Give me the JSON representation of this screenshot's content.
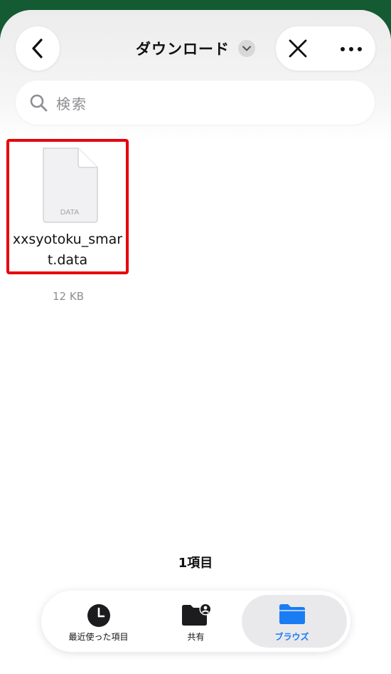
{
  "header": {
    "title": "ダウンロード",
    "back_icon": "chevron-left-icon",
    "title_menu_icon": "chevron-down-icon",
    "close_icon": "close-icon",
    "more_icon": "more-icon"
  },
  "search": {
    "placeholder": "検索",
    "icon": "search-icon"
  },
  "files": [
    {
      "name": "xxsyotoku_smart.data",
      "type_label": "DATA",
      "size": "12 KB",
      "selected": true
    }
  ],
  "item_count": "1項目",
  "tabs": [
    {
      "label": "最近使った項目",
      "icon": "clock-icon",
      "active": false
    },
    {
      "label": "共有",
      "icon": "shared-folder-icon",
      "active": false
    },
    {
      "label": "ブラウズ",
      "icon": "folder-icon",
      "active": true
    }
  ],
  "colors": {
    "accent": "#1a7cf2",
    "selection_border": "#e8000b",
    "status_bar": "#145a32"
  }
}
